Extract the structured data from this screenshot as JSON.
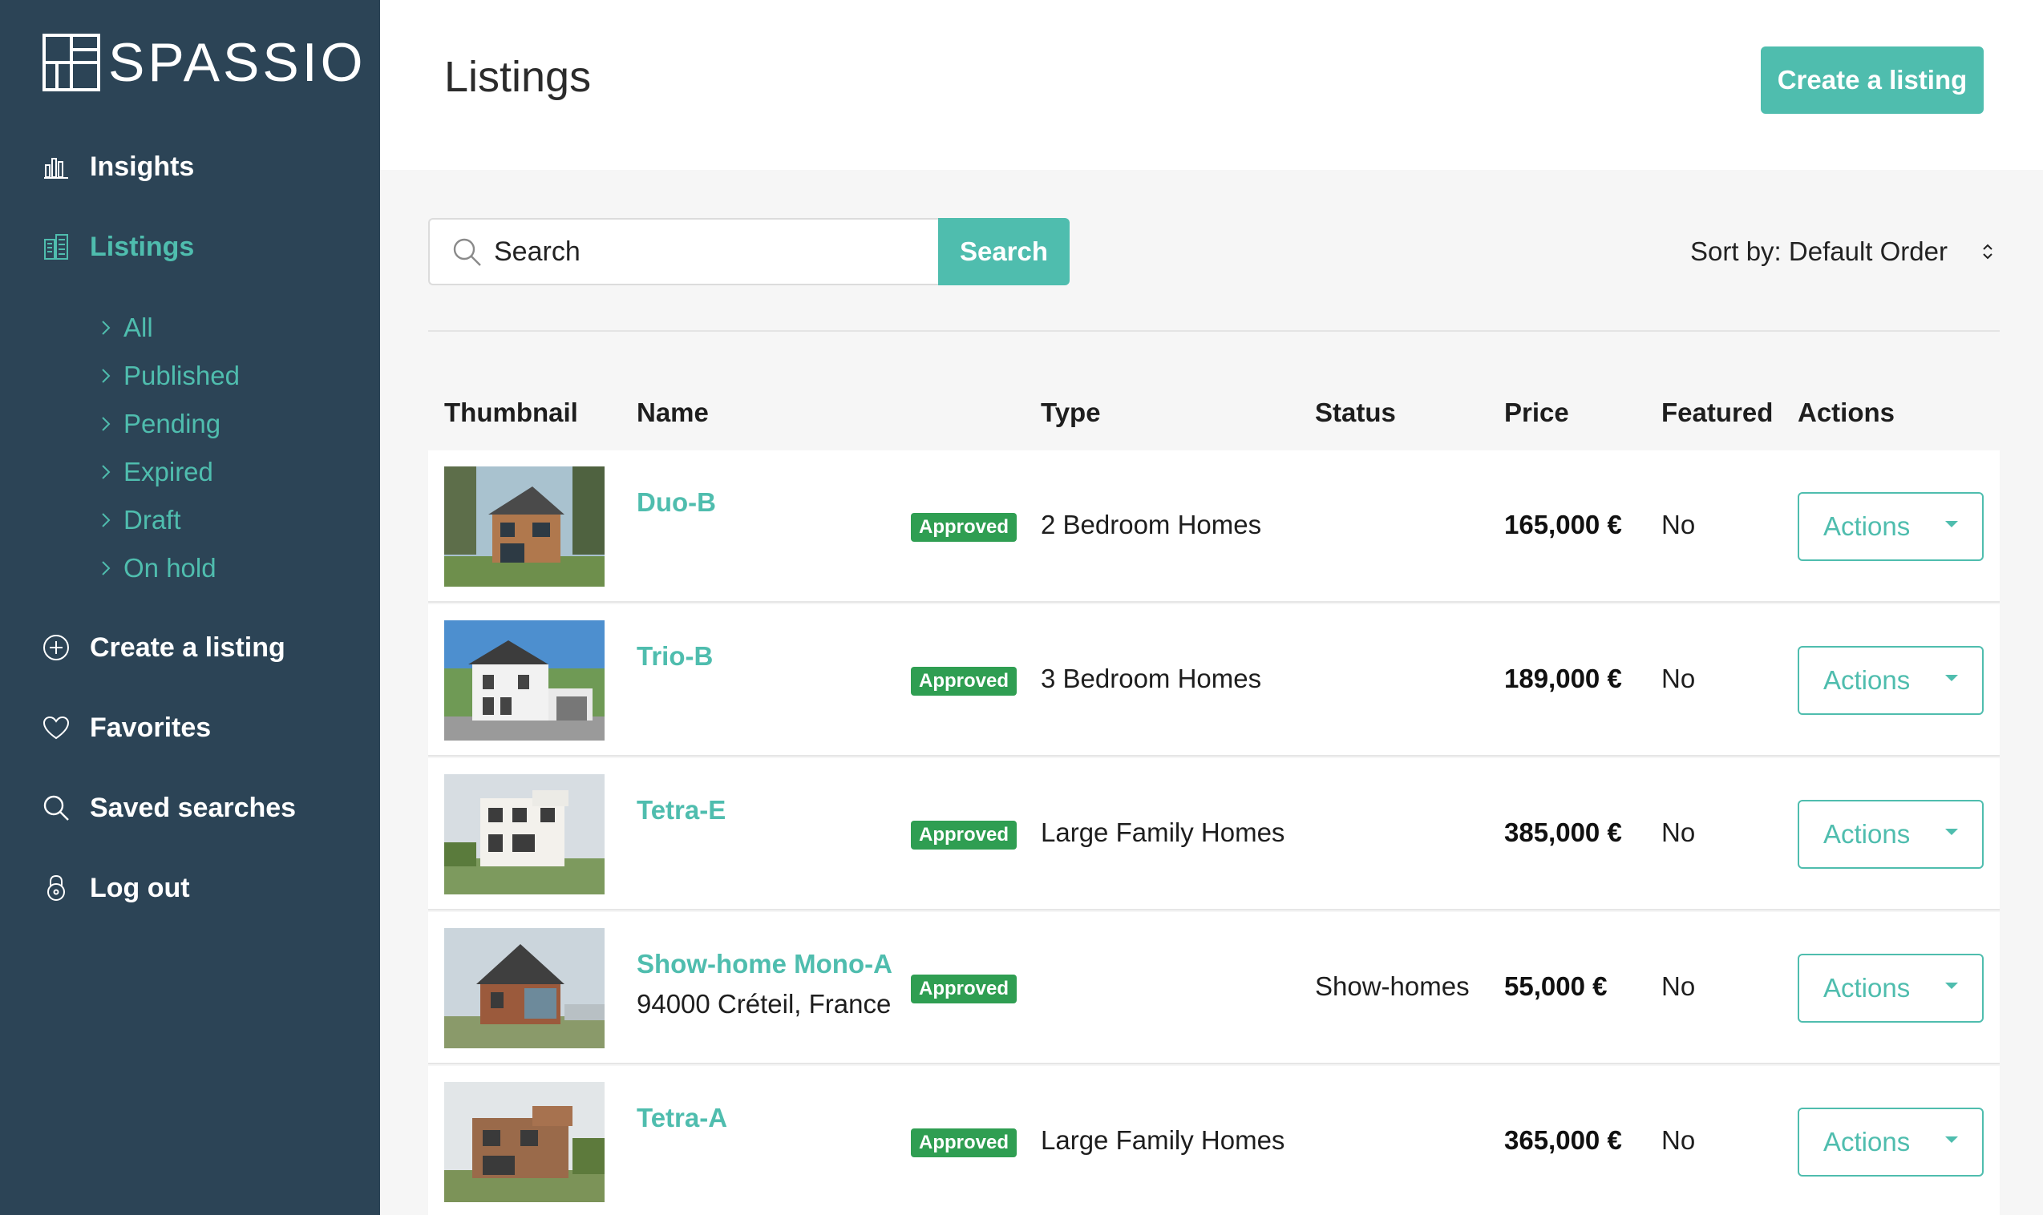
{
  "brand": {
    "name": "SPASSIO"
  },
  "sidebar": {
    "items": [
      {
        "label": "Insights",
        "icon": "bar-chart-icon"
      },
      {
        "label": "Listings",
        "icon": "buildings-icon"
      },
      {
        "label": "Create a listing",
        "icon": "plus-circle-icon"
      },
      {
        "label": "Favorites",
        "icon": "heart-icon"
      },
      {
        "label": "Saved searches",
        "icon": "search-icon"
      },
      {
        "label": "Log out",
        "icon": "lock-icon"
      }
    ],
    "sub_items": [
      {
        "label": "All"
      },
      {
        "label": "Published"
      },
      {
        "label": "Pending"
      },
      {
        "label": "Expired"
      },
      {
        "label": "Draft"
      },
      {
        "label": "On hold"
      }
    ]
  },
  "header": {
    "title": "Listings",
    "create_label": "Create a listing"
  },
  "search": {
    "placeholder": "Search",
    "button_label": "Search"
  },
  "sort": {
    "label": "Sort by: Default Order"
  },
  "table": {
    "columns": [
      "Thumbnail",
      "Name",
      "Type",
      "Status",
      "Price",
      "Featured",
      "Actions"
    ],
    "rows": [
      {
        "name": "Duo-B",
        "address": "",
        "badge": "Approved",
        "type": "2 Bedroom Homes",
        "status": "",
        "price": "165,000 €",
        "featured": "No",
        "action": "Actions"
      },
      {
        "name": "Trio-B",
        "address": "",
        "badge": "Approved",
        "type": "3 Bedroom Homes",
        "status": "",
        "price": "189,000 €",
        "featured": "No",
        "action": "Actions"
      },
      {
        "name": "Tetra-E",
        "address": "",
        "badge": "Approved",
        "type": "Large Family Homes",
        "status": "",
        "price": "385,000 €",
        "featured": "No",
        "action": "Actions"
      },
      {
        "name": "Show-home Mono-A",
        "address": "94000 Créteil, France",
        "badge": "Approved",
        "type": "",
        "status": "Show-homes",
        "price": "55,000 €",
        "featured": "No",
        "action": "Actions"
      },
      {
        "name": "Tetra-A",
        "address": "",
        "badge": "Approved",
        "type": "Large Family Homes",
        "status": "",
        "price": "365,000 €",
        "featured": "No",
        "action": "Actions"
      }
    ]
  },
  "colors": {
    "accent": "#4fbdae",
    "sidebar": "#2c4456",
    "badge": "#2f9e52"
  }
}
